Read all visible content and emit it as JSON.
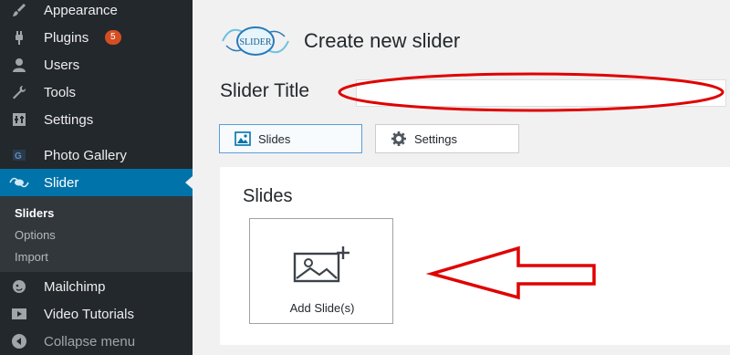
{
  "sidebar": {
    "items": [
      {
        "label": "Appearance",
        "icon": "paintbrush-icon"
      },
      {
        "label": "Plugins",
        "icon": "plugin-icon",
        "badge": "5"
      },
      {
        "label": "Users",
        "icon": "users-icon"
      },
      {
        "label": "Tools",
        "icon": "wrench-icon"
      },
      {
        "label": "Settings",
        "icon": "settings-icon"
      },
      {
        "label": "Photo Gallery",
        "icon": "photo-gallery-icon"
      },
      {
        "label": "Slider",
        "icon": "slider-icon"
      },
      {
        "label": "Mailchimp",
        "icon": "mailchimp-icon"
      },
      {
        "label": "Video Tutorials",
        "icon": "video-icon"
      },
      {
        "label": "Collapse menu",
        "icon": "collapse-icon"
      }
    ],
    "submenu": [
      {
        "label": "Sliders"
      },
      {
        "label": "Options"
      },
      {
        "label": "Import"
      }
    ]
  },
  "header": {
    "logo_text": "SLIDER",
    "title": "Create new slider"
  },
  "form": {
    "slider_title_label": "Slider Title",
    "slider_title_value": ""
  },
  "tabs": [
    {
      "label": "Slides",
      "icon": "image-icon",
      "active": true
    },
    {
      "label": "Settings",
      "icon": "gear-icon",
      "active": false
    }
  ],
  "slides_panel": {
    "title": "Slides",
    "add_label": "Add Slide(s)"
  },
  "colors": {
    "sidebar_bg": "#23282d",
    "active_blue": "#0073aa",
    "annotation_red": "#e00000"
  }
}
